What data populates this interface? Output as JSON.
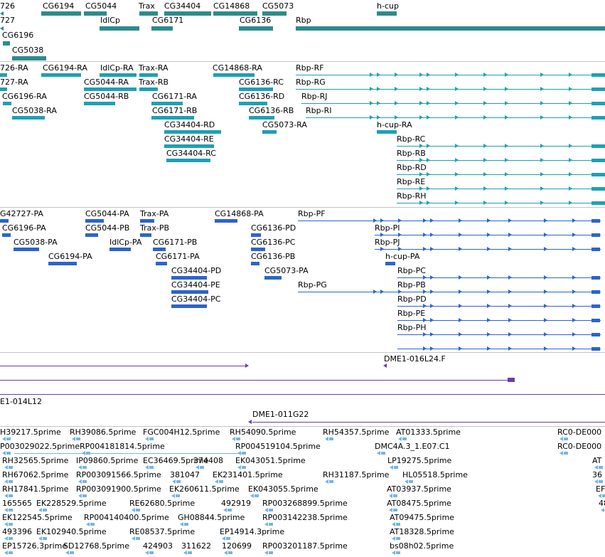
{
  "colors": {
    "gene": "#2e8b8b",
    "transcript": "#1ea0b4",
    "protein": "#2c64cc",
    "clone": "#6a3fa0",
    "est": "#74b4e4",
    "divider": "#c4c4c4"
  },
  "tracks": {
    "genes": {
      "labels": [
        "726",
        "CG6194",
        "CG5044",
        "Trax",
        "CG34404",
        "CG14868",
        "CG5073",
        "h-cup",
        "727",
        "IdlCp",
        "CG6171",
        "CG6136",
        "Rbp",
        "CG6196",
        "CG5038"
      ]
    },
    "transcripts": {
      "labels": [
        "726-RA",
        "CG6194-RA",
        "IdlCp-RA",
        "Trax-RA",
        "CG14868-RA",
        "Rbp-RF",
        "727-RA",
        "CG5044-RA",
        "Trax-RB",
        "CG6136-RC",
        "Rbp-RG",
        "CG6196-RA",
        "CG5044-RB",
        "CG6171-RA",
        "CG6136-RD",
        "Rbp-RJ",
        "CG5038-RA",
        "CG6171-RB",
        "CG6136-RB",
        "Rbp-RI",
        "CG34404-RD",
        "CG5073-RA",
        "h-cup-RA",
        "CG34404-RE",
        "Rbp-RC",
        "CG34404-RC",
        "Rbp-RB",
        "Rbp-RD",
        "Rbp-RE",
        "Rbp-RH"
      ]
    },
    "proteins": {
      "labels": [
        "G42727-PA",
        "CG5044-PA",
        "Trax-PA",
        "CG14868-PA",
        "Rbp-PF",
        "CG6196-PA",
        "CG5044-PB",
        "Trax-PB",
        "CG6136-PD",
        "Rbp-PI",
        "CG5038-PA",
        "IdlCp-PA",
        "CG6171-PB",
        "CG6136-PC",
        "Rbp-PJ",
        "CG6194-PA",
        "CG6171-PA",
        "CG6136-PB",
        "h-cup-PA",
        "CG34404-PD",
        "CG5073-PA",
        "Rbp-PC",
        "CG34404-PE",
        "Rbp-PG",
        "Rbp-PB",
        "CG34404-PC",
        "Rbp-PD",
        "Rbp-PE",
        "Rbp-PH"
      ]
    },
    "clones": {
      "labels": [
        "DME1-016L24.F",
        "E1-014L12",
        "DME1-011G22"
      ]
    },
    "ests": {
      "labels": [
        "H39217.5prime",
        "RH39086.5prime",
        "FGC004H12.5prime",
        "RH54090.5prime",
        "RH54357.5prime",
        "AT01333.5prime",
        "RC0-DE000",
        "P003029022.5prime",
        "RP004181814.5prime",
        "RP004519104.5prime",
        "DMC4A.3_1.E07.C1",
        "RC0-DE000",
        "RH32565.5prime",
        "IP09860.5prime",
        "EC36469.5prime",
        "374408",
        "EK043051.5prime",
        "LP19275.5prime",
        "AT",
        "RH67062.5prime",
        "RP003091566.5prime",
        "381047",
        "EK231401.5prime",
        "RH31187.5prime",
        "HL05518.5prime",
        "36",
        "RH17841.5prime",
        "RP003091900.5prime",
        "EK260611.5prime",
        "EK043055.5prime",
        "AT03937.5prime",
        "EF",
        "165565",
        "EK228529.5prime",
        "RE62680.5prime",
        "492919",
        "RP003268899.5prime",
        "AT08475.5prime",
        "48",
        "EK122545.5prime",
        "RP004140400.5prime",
        "GH08844.5prime",
        "RP003142238.5prime",
        "AT09475.5prime",
        "493396",
        "EK102940.5prime",
        "RE08537.5prime",
        "EP14914.3prime",
        "AT18328.5prime",
        "EP15726.3prime",
        "SD12768.5prime",
        "424903",
        "311622",
        "120699",
        "RP003201187.5prime",
        "bs08h02.5prime"
      ]
    }
  }
}
